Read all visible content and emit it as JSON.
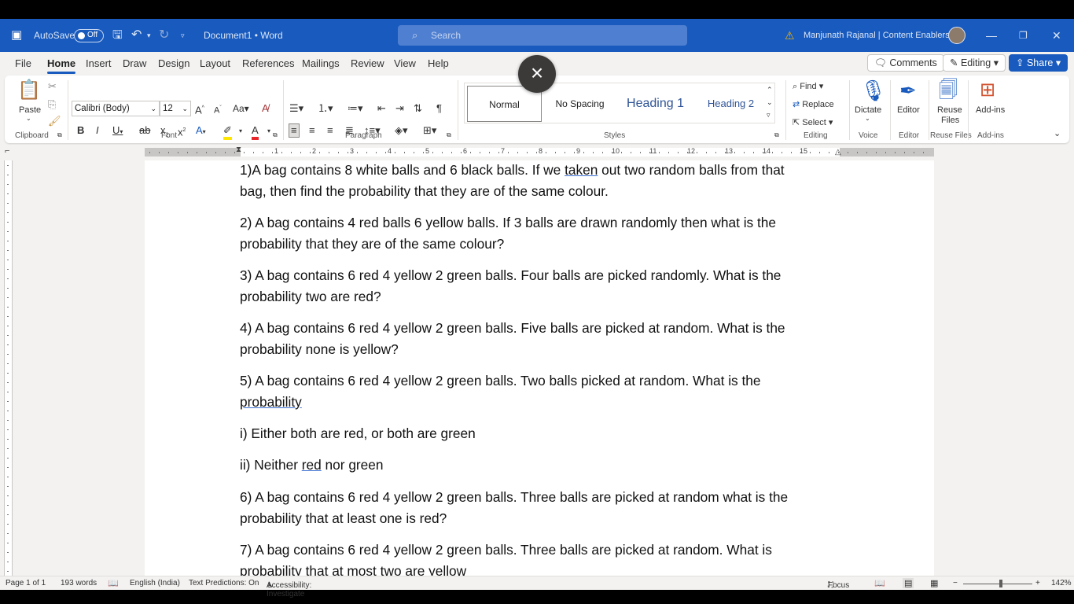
{
  "titlebar": {
    "autosave_label": "AutoSave",
    "autosave_state": "Off",
    "doc_title": "Document1",
    "app_sep": "•",
    "app_name": "Word",
    "search_placeholder": "Search",
    "user_name": "Manjunath Rajanal | Content Enablers"
  },
  "menu": {
    "tabs": [
      "File",
      "Home",
      "Insert",
      "Draw",
      "Design",
      "Layout",
      "References",
      "Mailings",
      "Review",
      "View",
      "Help"
    ],
    "comments_label": "Comments",
    "editing_label": "Editing",
    "share_label": "Share"
  },
  "ribbon": {
    "clipboard": {
      "paste": "Paste",
      "group": "Clipboard"
    },
    "font": {
      "family": "Calibri (Body)",
      "size": "12",
      "group": "Font"
    },
    "paragraph": {
      "group": "Paragraph"
    },
    "styles": {
      "items": [
        "Normal",
        "No Spacing",
        "Heading 1",
        "Heading 2"
      ],
      "group": "Styles"
    },
    "editing": {
      "find": "Find",
      "replace": "Replace",
      "select": "Select",
      "group": "Editing"
    },
    "voice": {
      "dictate": "Dictate",
      "group": "Voice"
    },
    "editor": {
      "label": "Editor",
      "group": "Editor"
    },
    "reuse": {
      "label1": "Reuse",
      "label2": "Files",
      "group": "Reuse Files"
    },
    "addins": {
      "label": "Add-ins",
      "group": "Add-ins"
    }
  },
  "ruler": {
    "numbers": [
      "1",
      "2",
      "3",
      "4",
      "5",
      "6",
      "7",
      "8",
      "9",
      "10",
      "11",
      "12",
      "13",
      "14",
      "15"
    ]
  },
  "document": {
    "p1a": "1)A bag contains 8 white balls and 6 black balls. If we ",
    "p1u": "taken",
    "p1b": " out two random balls from that",
    "p1c": "bag, then find the probability that they are of the same colour.",
    "p2a": "2) A bag contains 4 red balls 6 yellow balls. If 3 balls are drawn randomly then what is the",
    "p2b": "probability that they are of the same colour?",
    "p3a": "3) A bag contains 6 red 4 yellow 2 green balls. Four balls are picked randomly. What is the",
    "p3b": "probability two are red?",
    "p4a": "4) A bag contains 6 red 4 yellow 2 green balls. Five balls are picked at random. What is the",
    "p4b": "probability none is yellow?",
    "p5a": "5) A bag contains 6 red 4 yellow 2 green balls. Two balls picked at random. What is the",
    "p5b": "probability",
    "p6": "i) Either both are red, or both are green",
    "p7a": "ii) Neither ",
    "p7u": "red",
    "p7b": " nor green",
    "p8a": "6)  A bag contains 6 red 4 yellow 2 green balls. Three balls are picked at random what is the",
    "p8b": "probability that at least one is red?",
    "p9a": "7) A bag contains 6 red 4 yellow 2 green balls. Three balls are picked at random. What is",
    "p9b": "probability that at most two are yellow"
  },
  "status": {
    "page": "Page 1 of 1",
    "words": "193 words",
    "language": "English (India)",
    "predictions": "Text Predictions: On",
    "accessibility": "Accessibility: Investigate",
    "focus": "Focus",
    "zoom": "142%"
  },
  "colors": {
    "accent": "#185abd",
    "ribbon_bg": "#f3f2f1"
  }
}
